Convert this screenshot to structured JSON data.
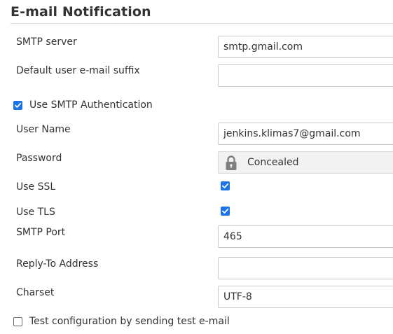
{
  "section": {
    "title": "E-mail Notification"
  },
  "smtp_server": {
    "label": "SMTP server",
    "value": "smtp.gmail.com"
  },
  "default_suffix": {
    "label": "Default user e-mail suffix",
    "value": ""
  },
  "use_smtp_auth": {
    "label": "Use SMTP Authentication",
    "checked": true
  },
  "user_name": {
    "label": "User Name",
    "value": "jenkins.klimas7@gmail.com"
  },
  "password": {
    "label": "Password",
    "value": "Concealed",
    "icon": "lock-icon"
  },
  "use_ssl": {
    "label": "Use SSL",
    "checked": true
  },
  "use_tls": {
    "label": "Use TLS",
    "checked": true
  },
  "smtp_port": {
    "label": "SMTP Port",
    "value": "465"
  },
  "reply_to": {
    "label": "Reply-To Address",
    "value": ""
  },
  "charset": {
    "label": "Charset",
    "value": "UTF-8"
  },
  "test_config": {
    "label": "Test configuration by sending test e-mail",
    "checked": false
  },
  "colors": {
    "checkbox_accent": "#1a73e8",
    "text": "#333333",
    "concealed_bg": "#f2f2f2",
    "field_border": "#c9c9c9"
  }
}
